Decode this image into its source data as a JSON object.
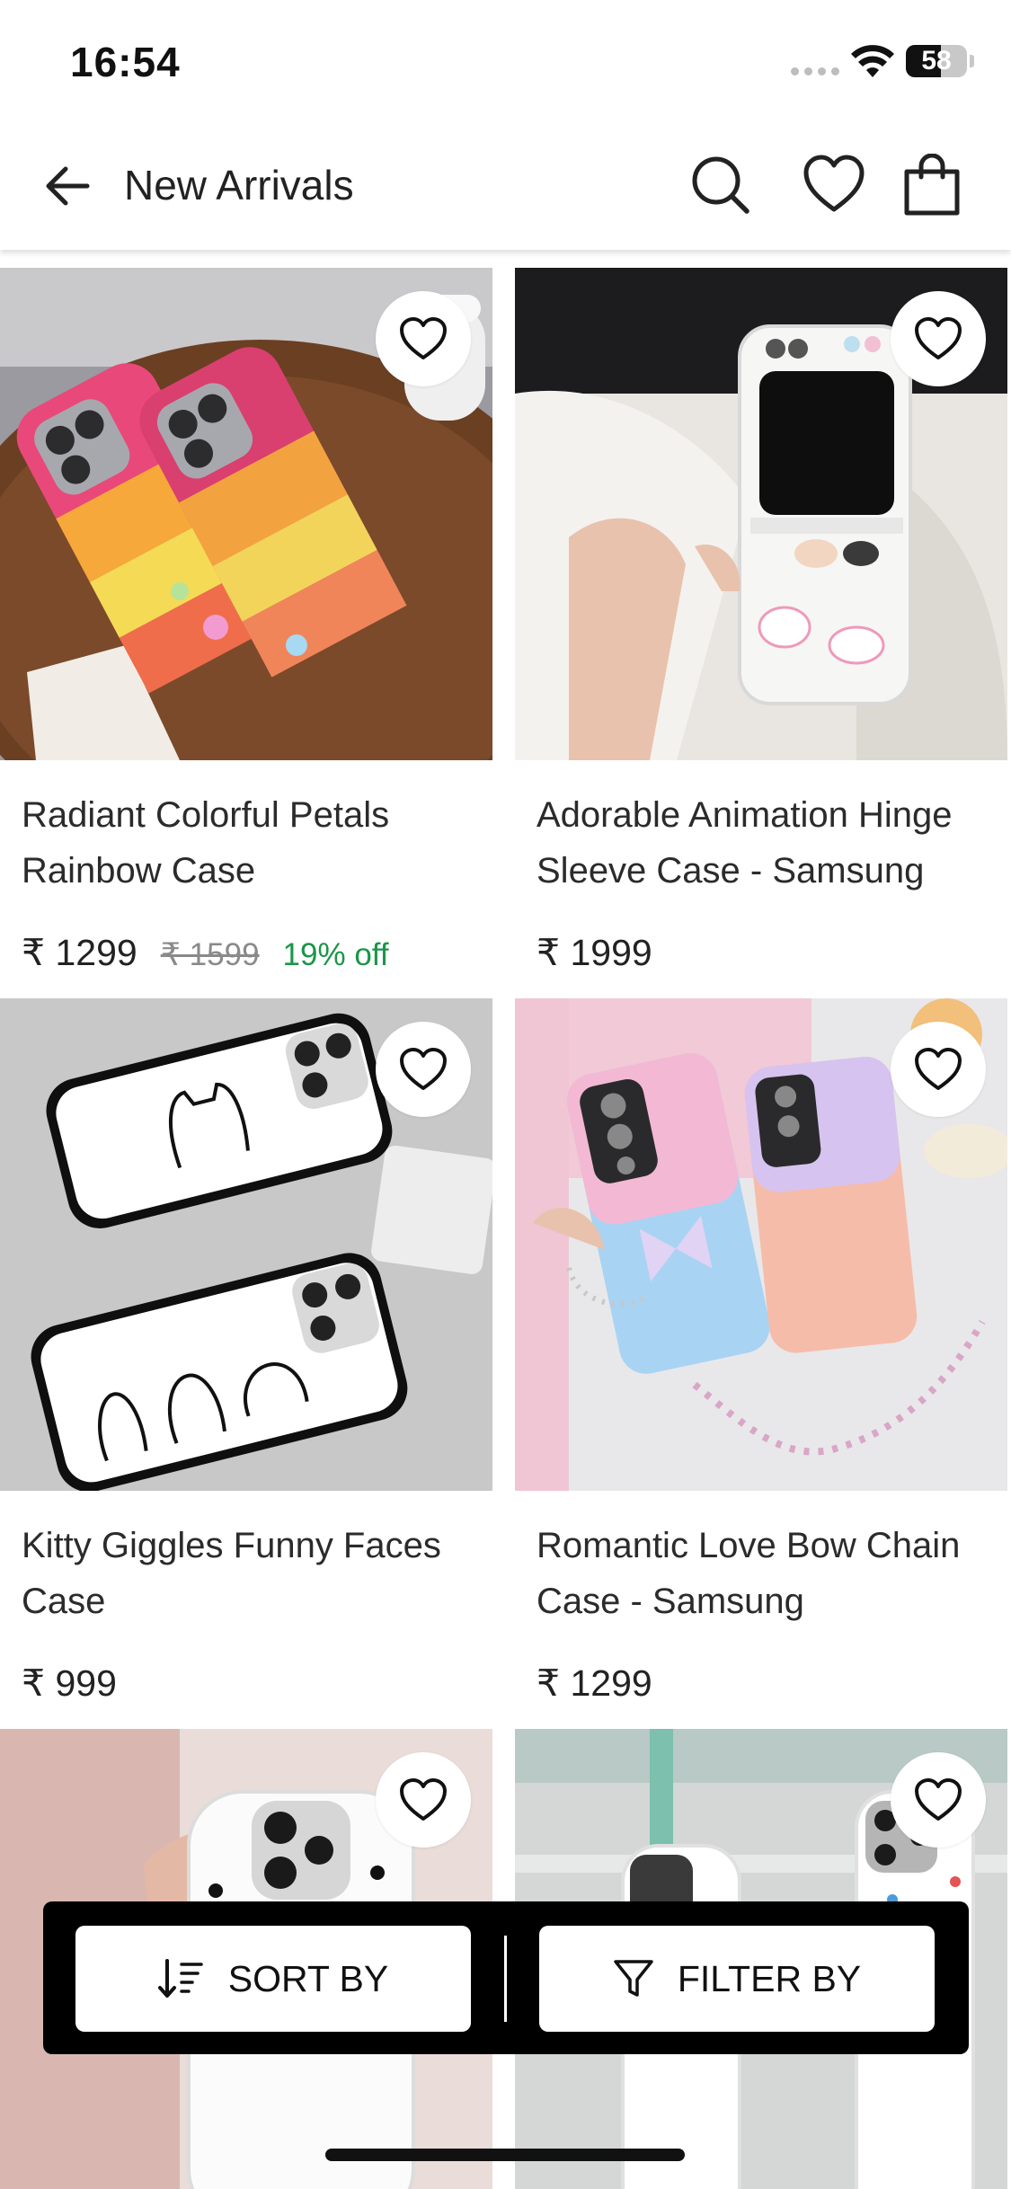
{
  "status": {
    "time": "16:54",
    "battery": "58",
    "battery_level": 0.58
  },
  "header": {
    "title": "New Arrivals",
    "icons": [
      "back-arrow-icon",
      "search-icon",
      "heart-icon",
      "shopping-bag-icon"
    ]
  },
  "products": [
    {
      "name": "Radiant Colorful Petals Rainbow Case",
      "price": "₹ 1299",
      "mrp": "₹ 1599",
      "discount": "19% off"
    },
    {
      "name": "Adorable Animation Hinge Sleeve Case - Samsung",
      "price": "₹ 1999"
    },
    {
      "name": "Kitty Giggles Funny Faces Case",
      "price": "₹ 999"
    },
    {
      "name": "Romantic Love Bow Chain Case - Samsung",
      "price": "₹ 1299"
    },
    {
      "name": "",
      "price": ""
    },
    {
      "name": "",
      "price": ""
    }
  ],
  "bottom_bar": {
    "sort_label": "SORT BY",
    "filter_label": "FILTER BY"
  },
  "colors": {
    "discount": "#1a9648",
    "bar": "#000000"
  }
}
